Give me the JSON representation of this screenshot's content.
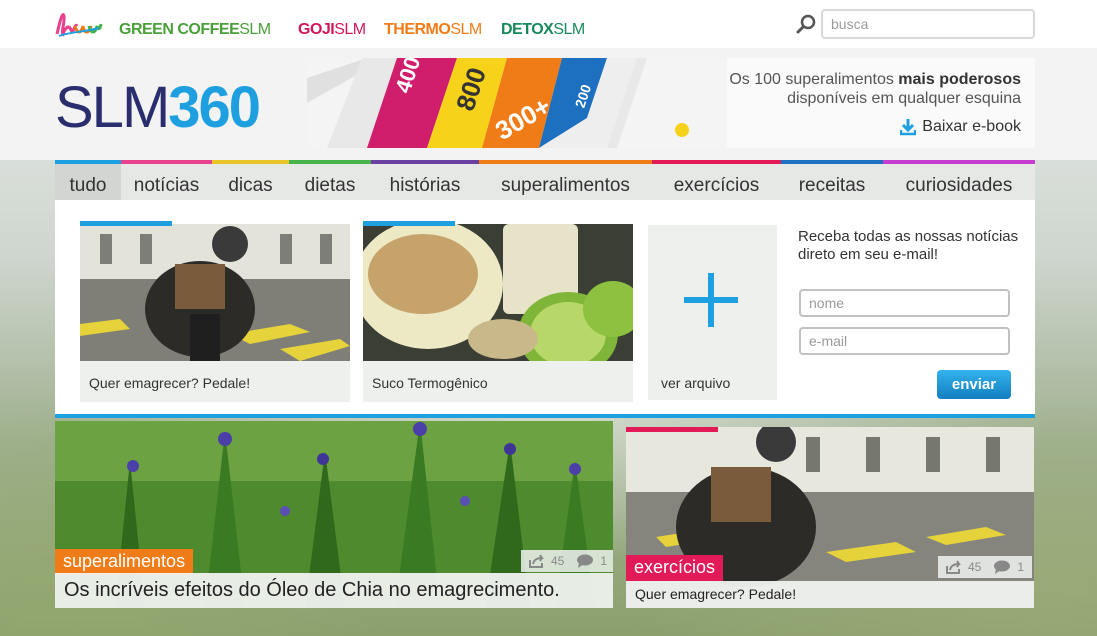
{
  "top_nav": {
    "brands": [
      {
        "bold": "GREEN COFFEE",
        "thin": "SLM",
        "color": "#4aa13a"
      },
      {
        "bold": "GOJI",
        "thin": "SLM",
        "color": "#d1175b"
      },
      {
        "bold": "THERMO",
        "thin": "SLM",
        "color": "#f07c18"
      },
      {
        "bold": "DETOX",
        "thin": "SLM",
        "color": "#178a5b"
      }
    ],
    "search_placeholder": "busca"
  },
  "logo": {
    "slm": "SLM",
    "num": "360"
  },
  "banner": {
    "line1_prefix": "Os 100 superalimentos ",
    "line1_bold": "mais poderosos",
    "line2": "disponíveis em qualquer esquina",
    "download_label": "Baixar e-book",
    "book_numbers": [
      "400",
      "800",
      "300+",
      "200"
    ]
  },
  "nav": {
    "items": [
      {
        "label": "tudo",
        "color": "#1d9fe0"
      },
      {
        "label": "notícias",
        "color": "#e8418e"
      },
      {
        "label": "dicas",
        "color": "#e9c52a"
      },
      {
        "label": "dietas",
        "color": "#46b34b"
      },
      {
        "label": "histórias",
        "color": "#6b3fa0"
      },
      {
        "label": "superalimentos",
        "color": "#f07c18"
      },
      {
        "label": "exercícios",
        "color": "#e21a57"
      },
      {
        "label": "receitas",
        "color": "#1d6fc0"
      },
      {
        "label": "curiosidades",
        "color": "#c63bd0"
      }
    ]
  },
  "cards": [
    {
      "caption": "Quer emagrecer? Pedale!"
    },
    {
      "caption": "Suco Termogênico"
    }
  ],
  "more_card": {
    "caption": "ver arquivo"
  },
  "newsletter": {
    "text": "Receba todas as nossas notícias direto em seu e-mail!",
    "name_placeholder": "nome",
    "email_placeholder": "e-mail",
    "send_label": "enviar"
  },
  "features": [
    {
      "tag": "superalimentos",
      "tag_color": "#f07c18",
      "title": "Os incríveis efeitos do Óleo de Chia no emagrecimento.",
      "shares": "45",
      "comments": "1"
    },
    {
      "tag": "exercícios",
      "tag_color": "#e21a57",
      "title": "Quer emagrecer? Pedale!",
      "shares": "45",
      "comments": "1"
    }
  ]
}
